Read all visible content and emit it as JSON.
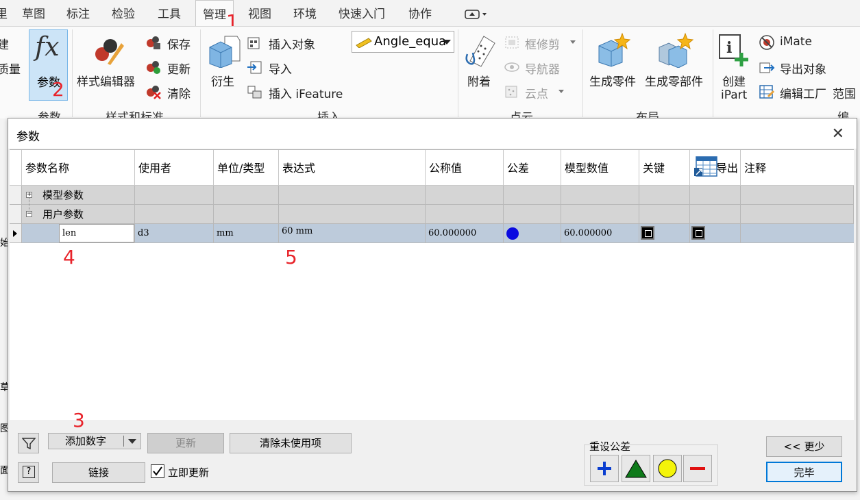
{
  "menu": {
    "m0": "草图",
    "m1": "标注",
    "m2": "检验",
    "m3": "工具",
    "m4": "管理",
    "m5": "视图",
    "m6": "环境",
    "m7": "快速入门",
    "m8": "协作"
  },
  "ribbon": {
    "left_cut_1": "建",
    "left_cut_2": "质量",
    "params": "参数",
    "style_editor": "样式编辑器",
    "save": "保存",
    "update": "更新",
    "clear": "清除",
    "derive": "衍生",
    "insert_object": "插入对象",
    "import": "导入",
    "insert_ifeature": "插入 iFeature",
    "angle_dropdown": "Angle_equa",
    "attach": "附着",
    "frame_trim": "框修剪",
    "navigator": "导航器",
    "cloud_point": "云点",
    "gen_part": "生成零件",
    "gen_parts": "生成零部件",
    "create": "创建",
    "ipart": "iPart",
    "imate": "iMate",
    "export_object": "导出对象",
    "edit_factory": "编辑工厂",
    "range": "范围",
    "grp_params": "参数",
    "grp_style": "样式和标准",
    "grp_insert": "插入",
    "grp_cloud": "点云",
    "grp_layout": "布局",
    "grp_author": "编写"
  },
  "annotations": {
    "a1": "1",
    "a2": "2",
    "a3": "3",
    "a4": "4",
    "a5": "5"
  },
  "dialog": {
    "title": "参数",
    "columns": [
      "参数名称",
      "使用者",
      "单位/类型",
      "表达式",
      "公称值",
      "公差",
      "模型数值",
      "关键",
      "导出",
      "注释"
    ],
    "group_model": "模型参数",
    "group_user": "用户参数",
    "row": {
      "name": "len",
      "used_by": "d3",
      "unit": "mm",
      "expression": "60 mm",
      "nominal": "60.000000",
      "model_value": "60.000000"
    },
    "add_number": "添加数字",
    "update_btn": "更新",
    "purge_btn": "清除未使用项",
    "link_btn": "链接",
    "immediate_update": "立即更新",
    "reset_tol": "重设公差",
    "less_btn": "<< 更少",
    "done_btn": "完毕",
    "help": "?"
  },
  "behind": {
    "b1": "始",
    "b2": "草",
    "b3": "图",
    "b4": "面"
  }
}
